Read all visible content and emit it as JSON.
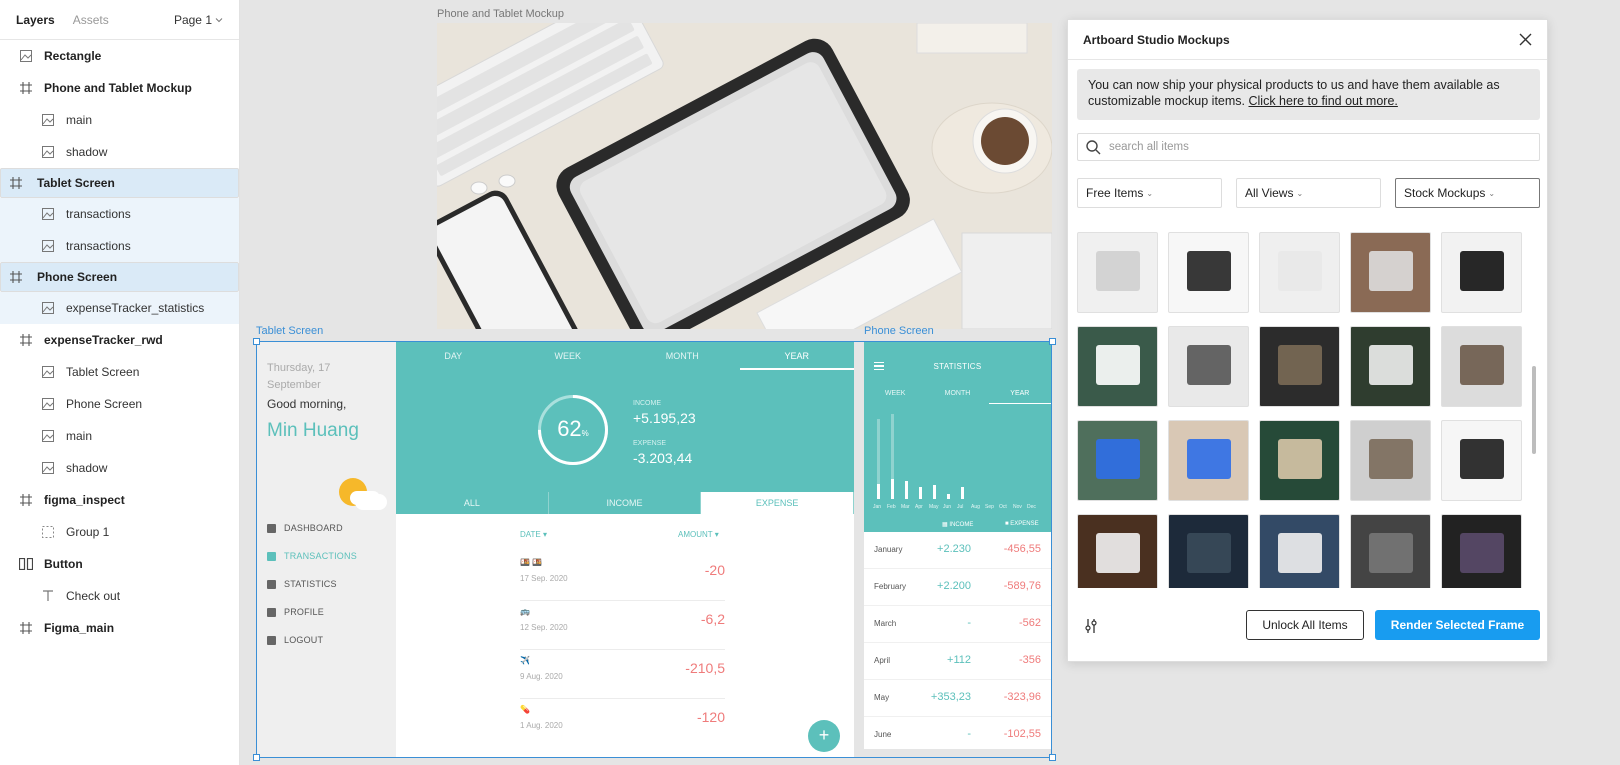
{
  "layers_panel": {
    "tab_layers": "Layers",
    "tab_assets": "Assets",
    "page": "Page 1",
    "items": [
      {
        "label": "Rectangle",
        "type": "image"
      },
      {
        "label": "Phone and Tablet Mockup",
        "type": "frame"
      },
      {
        "label": "main",
        "type": "image"
      },
      {
        "label": "shadow",
        "type": "image"
      },
      {
        "label": "Tablet Screen",
        "type": "frame"
      },
      {
        "label": "transactions",
        "type": "image"
      },
      {
        "label": "transactions",
        "type": "image"
      },
      {
        "label": "Phone Screen",
        "type": "frame"
      },
      {
        "label": "expenseTracker_statistics",
        "type": "image"
      },
      {
        "label": "expenseTracker_rwd",
        "type": "frame"
      },
      {
        "label": "Tablet Screen",
        "type": "image"
      },
      {
        "label": "Phone Screen",
        "type": "image"
      },
      {
        "label": "main",
        "type": "image"
      },
      {
        "label": "shadow",
        "type": "image"
      },
      {
        "label": "figma_inspect",
        "type": "frame"
      },
      {
        "label": "Group 1",
        "type": "group"
      },
      {
        "label": "Button",
        "type": "component"
      },
      {
        "label": "Check out",
        "type": "text"
      },
      {
        "label": "Figma_main",
        "type": "frame"
      }
    ]
  },
  "canvas": {
    "mockup_label": "Phone and Tablet Mockup",
    "tablet_label": "Tablet Screen",
    "phone_label": "Phone Screen"
  },
  "tablet": {
    "date": "Thursday, 17 September",
    "greeting": "Good morning,",
    "user_name": "Min Huang",
    "nav": [
      "DASHBOARD",
      "TRANSACTIONS",
      "STATISTICS",
      "PROFILE",
      "LOGOUT"
    ],
    "period_tabs": [
      "DAY",
      "WEEK",
      "MONTH",
      "YEAR"
    ],
    "percent": "62",
    "percent_sign": "%",
    "income_label": "INCOME",
    "income_value": "+5.195,23",
    "expense_label": "EXPENSE",
    "expense_value": "-3.203,44",
    "filters": [
      "ALL",
      "INCOME",
      "EXPENSE"
    ],
    "date_header": "DATE",
    "amount_header": "AMOUNT",
    "transactions": [
      {
        "date": "17 Sep. 2020",
        "amount": "-20",
        "icon": "🍱 🍱"
      },
      {
        "date": "12 Sep. 2020",
        "amount": "-6,2",
        "icon": "🚌"
      },
      {
        "date": "9 Aug. 2020",
        "amount": "-210,5",
        "icon": "✈️"
      },
      {
        "date": "1 Aug. 2020",
        "amount": "-120",
        "icon": "💊"
      }
    ],
    "fab": "+"
  },
  "phone": {
    "title": "STATISTICS",
    "tabs": [
      "WEEK",
      "MONTH",
      "YEAR"
    ],
    "chart_months": [
      "Jan",
      "Feb",
      "Mar",
      "Apr",
      "May",
      "Jun",
      "Jul",
      "Aug",
      "Sep",
      "Oct",
      "Nov",
      "Dec"
    ],
    "legend_income": "INCOME",
    "legend_expense": "EXPENSE",
    "rows": [
      {
        "month": "January",
        "income": "+2.230",
        "expense": "-456,55"
      },
      {
        "month": "February",
        "income": "+2.200",
        "expense": "-589,76"
      },
      {
        "month": "March",
        "income": "-",
        "expense": "-562"
      },
      {
        "month": "April",
        "income": "+112",
        "expense": "-356"
      },
      {
        "month": "May",
        "income": "+353,23",
        "expense": "-323,96"
      },
      {
        "month": "June",
        "income": "-",
        "expense": "-102,55"
      }
    ]
  },
  "dialog": {
    "title": "Artboard Studio Mockups",
    "notice_text": "You can now ship your physical products to us and have them available as customizable mockup items.",
    "notice_link": "Click here to find out more.",
    "search_placeholder": "search all items",
    "filter_price": "Free Items",
    "filter_views": "All Views",
    "filter_category": "Stock Mockups",
    "unlock_button": "Unlock All Items",
    "render_button": "Render Selected Frame"
  },
  "colors": {
    "accent_teal": "#5cc0bb",
    "expense_red": "#ef7b7b",
    "primary_blue": "#189cf0",
    "selection_blue": "#3a8fd6"
  }
}
